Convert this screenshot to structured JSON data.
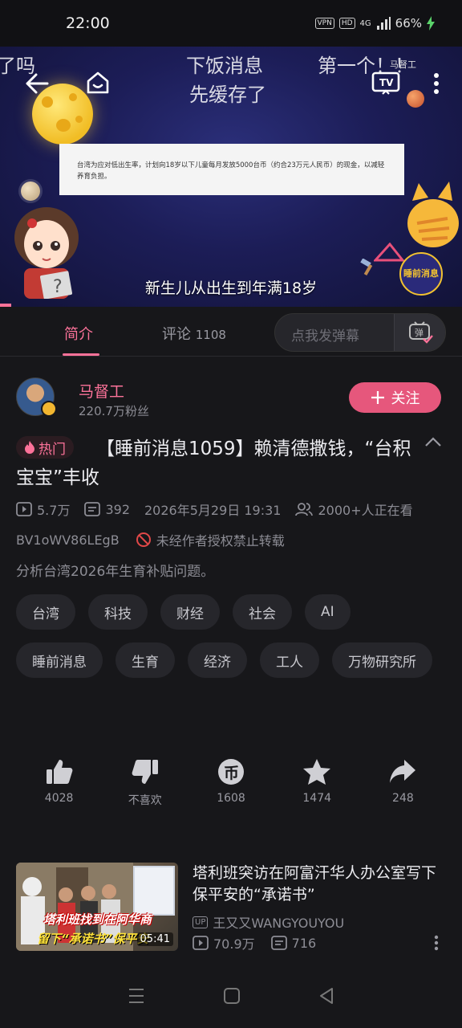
{
  "status_bar": {
    "time": "22:00",
    "vpn": "VPN",
    "hd": "HD",
    "network": "4G",
    "battery": "66%"
  },
  "video": {
    "danmaku": [
      "了吗",
      "下饭消息",
      "第一个！！",
      "先缓存了"
    ],
    "watermark": "马督工",
    "notice_text": "台湾为应对低出生率，计划向18岁以下儿童每月发放5000台币（约合23万元人民币）的现金，以减轻养育负担。",
    "subtitle": "新生儿从出生到年满18岁",
    "badge": "睡前消息",
    "progress": 0.0
  },
  "tabs": [
    {
      "label": "简介",
      "active": true
    },
    {
      "label": "评论",
      "count": "1108"
    }
  ],
  "danmaku_input": {
    "placeholder": "点我发弹幕",
    "button": "弹"
  },
  "uploader": {
    "name": "马督工",
    "fans": "220.7万粉丝",
    "follow_label": "关注"
  },
  "video_info": {
    "hot_label": "热门",
    "title": "【睡前消息1059】赖清德撒钱，“台积宝宝”丰收",
    "plays": "5.7万",
    "danmaku_count": "392",
    "date": "2026年5月29日 19:31",
    "watching": "2000+人正在看",
    "bvid": "BV1oWV86LEgB",
    "no_repost": "未经作者授权禁止转载",
    "description": "分析台湾2026年生育补贴问题。"
  },
  "tags": [
    "台湾",
    "科技",
    "财经",
    "社会",
    "AI",
    "睡前消息",
    "生育",
    "经济",
    "工人",
    "万物研究所"
  ],
  "actions": [
    {
      "icon": "like-icon",
      "label": "4028"
    },
    {
      "icon": "dislike-icon",
      "label": "不喜欢"
    },
    {
      "icon": "coin-icon",
      "label": "1608"
    },
    {
      "icon": "star-icon",
      "label": "1474"
    },
    {
      "icon": "share-icon",
      "label": "248"
    }
  ],
  "recommendation": {
    "title": "塔利班突访在阿富汗华人办公室写下保平安的“承诺书”",
    "thumb_caption_1": "塔利班找到在阿华商",
    "thumb_caption_2": "留下“承诺书”保平安",
    "duration": "05:41",
    "up_chip": "UP",
    "uploader": "王又又WANGYOUYOU",
    "plays": "70.9万",
    "danmaku": "716"
  },
  "colors": {
    "accent": "#fb7299",
    "follow_bg": "#e6577c",
    "background": "#17171a"
  }
}
